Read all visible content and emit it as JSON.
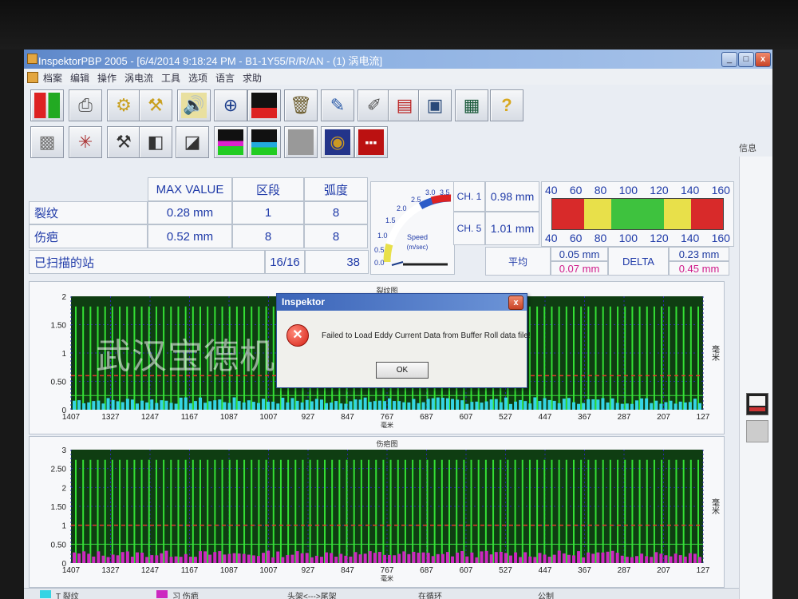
{
  "window": {
    "title": "InspektorPBP 2005 - [6/4/2014 9:18:24 PM - B1-1Y55/R/R/AN - (1) 涡电流]",
    "minimize": "_",
    "maximize": "□",
    "close": "x"
  },
  "menu": [
    "档案",
    "编辑",
    "操作",
    "涡电流",
    "工具",
    "选项",
    "语言",
    "求助"
  ],
  "toolbar": {
    "row1": [
      "layout-icon",
      "printer-icon",
      "probe-icon",
      "probe-settings-icon",
      "speaker-icon",
      "crosshair-icon",
      "spectrum-icon",
      "bucket-icon",
      "notepad-icon",
      "edit-chart-icon",
      "calendar-icon",
      "window-icon",
      "calculator-icon",
      "help-icon"
    ],
    "row2": [
      "grid-icon",
      "vector-icon",
      "hammer-icon",
      "block-icon",
      "eraser-icon",
      "histogram-icon",
      "trend-icon",
      "blank-icon",
      "globe-icon",
      "ruler-icon"
    ]
  },
  "info_label": "信息",
  "summary": {
    "headers": [
      "MAX VALUE",
      "区段",
      "弧度"
    ],
    "rows": [
      {
        "label": "裂纹",
        "max": "0.28 mm",
        "segment": "1",
        "arc": "8"
      },
      {
        "label": "伤疤",
        "max": "0.52 mm",
        "segment": "8",
        "arc": "8"
      }
    ],
    "scanned_label": "已扫描的站",
    "scanned_value": "16/16",
    "scanned_count": "38"
  },
  "speed_gauge": {
    "label_line1": "Speed",
    "label_line2": "(m/sec)",
    "ticks": [
      "0.0",
      "0.5",
      "1.0",
      "1.5",
      "2.0",
      "2.5",
      "3.0",
      "3.5"
    ]
  },
  "channels": {
    "ch1_label": "CH. 1",
    "ch1_value": "0.98 mm",
    "ch5_label": "CH. 5",
    "ch5_value": "1.01 mm",
    "avg_label": "平均",
    "avg_blue": "0.05 mm",
    "avg_pink": "0.07 mm",
    "delta_label": "DELTA",
    "delta_blue": "0.23 mm",
    "delta_pink": "0.45 mm"
  },
  "scale_bar": {
    "ticks": [
      "40",
      "60",
      "80",
      "100",
      "120",
      "140",
      "160"
    ],
    "colors": [
      "#d82a2a",
      "#e8e04a",
      "#3ec23e",
      "#e8e04a",
      "#d82a2a"
    ]
  },
  "crack_chart": {
    "title": "裂纹图",
    "y_ticks": [
      "2",
      "1.50",
      "1",
      "0.50",
      "0"
    ],
    "x_ticks": [
      "1407",
      "1327",
      "1247",
      "1167",
      "1087",
      "1007",
      "927",
      "847",
      "767",
      "687",
      "607",
      "527",
      "447",
      "367",
      "287",
      "207",
      "127"
    ],
    "x_unit": "毫米",
    "y_unit": "毫米",
    "bar_color": "#34d4e4",
    "threshold_red": 0.6,
    "threshold_green": 0.25
  },
  "scar_chart": {
    "title": "伤疤图",
    "y_ticks": [
      "3",
      "2.50",
      "2",
      "1.50",
      "1",
      "0.50",
      "0"
    ],
    "x_ticks": [
      "1407",
      "1327",
      "1247",
      "1167",
      "1087",
      "1007",
      "927",
      "847",
      "767",
      "687",
      "607",
      "527",
      "447",
      "367",
      "287",
      "207",
      "127"
    ],
    "x_unit": "毫米",
    "y_unit": "毫米",
    "bar_color": "#cc28c0",
    "threshold_red": 1.0,
    "threshold_green": 0.5
  },
  "dialog": {
    "title": "Inspektor",
    "message": "Failed to Load Eddy Current Data from Buffer Roll data file!",
    "ok": "OK",
    "close": "x"
  },
  "watermark": "武汉宝德机电股份有限公司",
  "statusbar": {
    "items": [
      {
        "text": "T  裂纹",
        "color": "#34d4e4"
      },
      {
        "text": "习  伤疤",
        "color": "#cc28c0"
      },
      {
        "text": "头架<--->尾架",
        "color": ""
      },
      {
        "text": "在循环",
        "color": ""
      },
      {
        "text": "公制",
        "color": ""
      }
    ]
  }
}
